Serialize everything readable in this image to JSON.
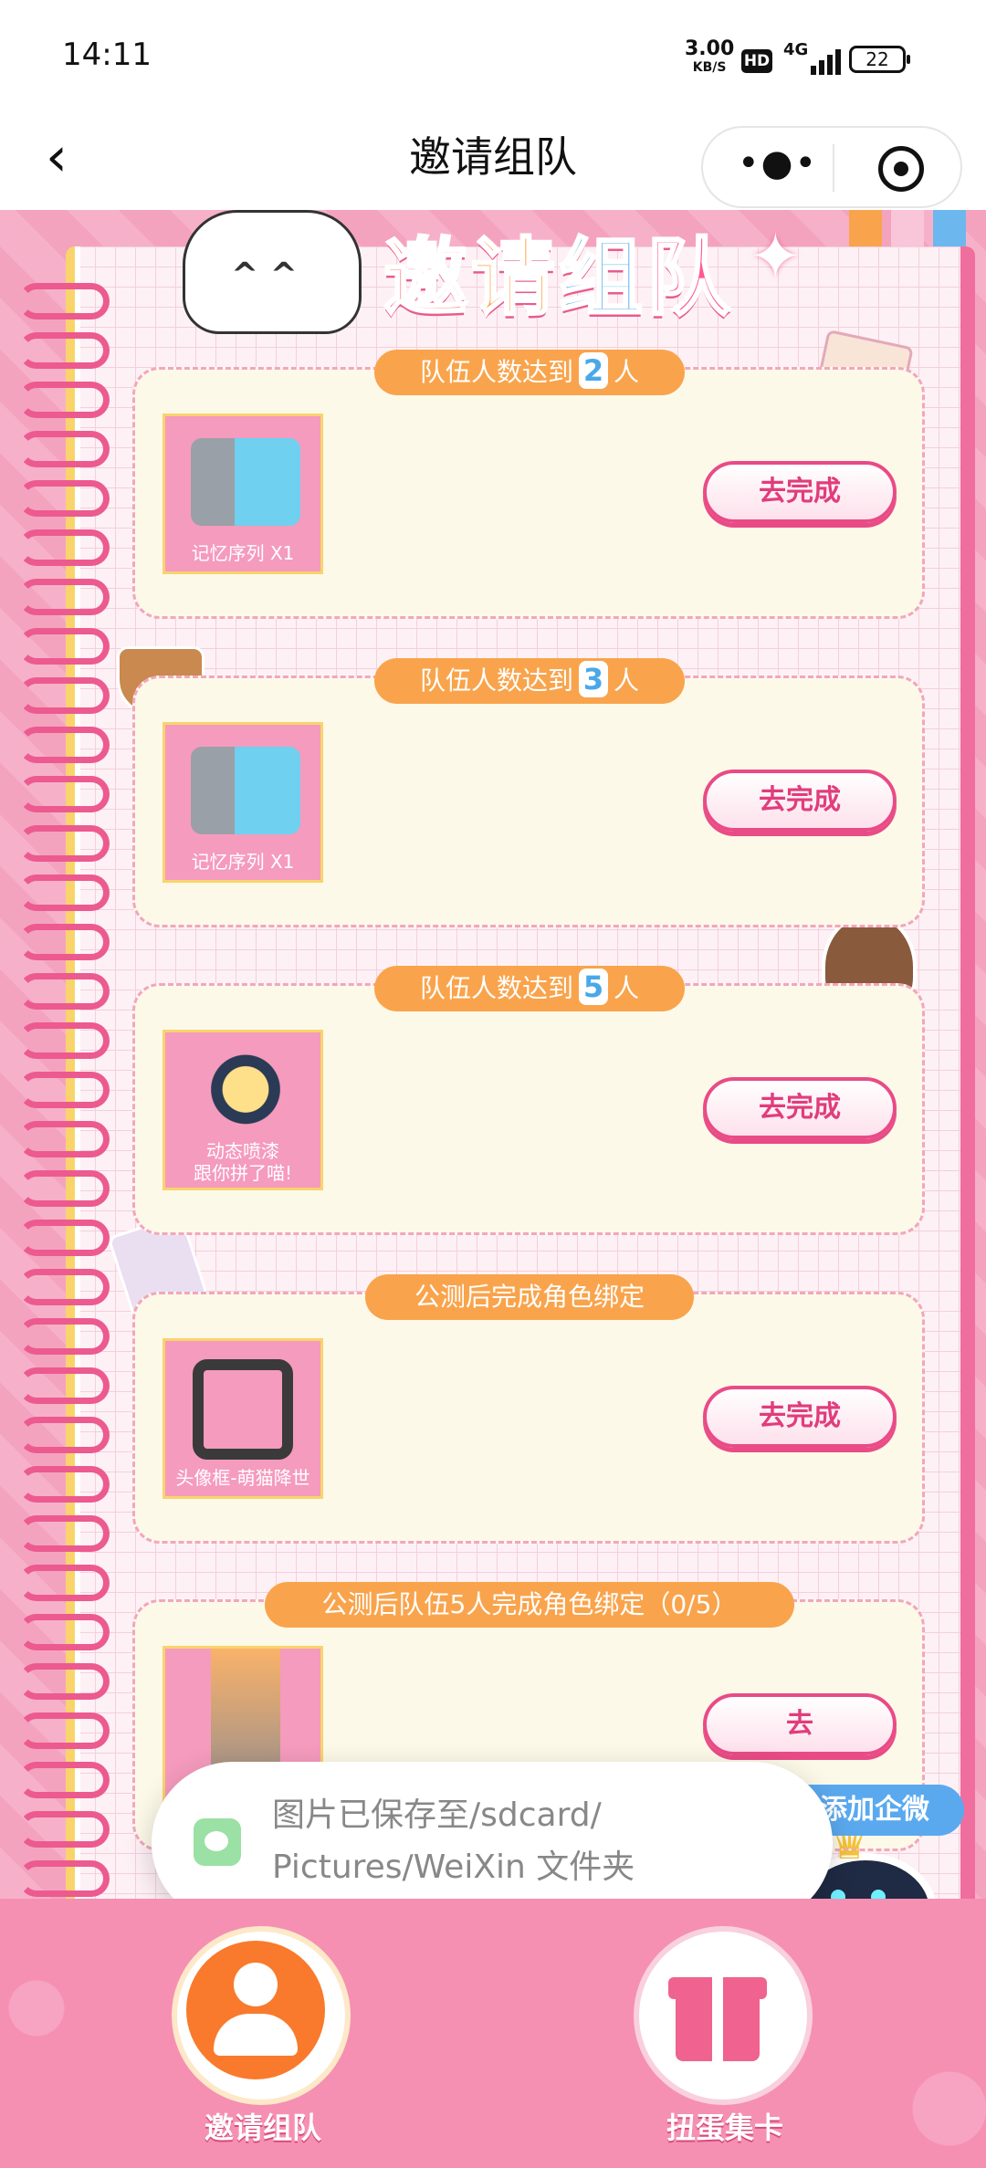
{
  "status_bar": {
    "time": "14:11",
    "net_speed": "3.00",
    "net_unit": "KB/S",
    "hd": "HD",
    "signal": "4G",
    "battery": "22"
  },
  "title_bar": {
    "title": "邀请组队",
    "back_icon": "chevron-left-icon",
    "more_icon": "more-dots-icon",
    "close_icon": "target-icon"
  },
  "banner": {
    "title_chars": [
      "邀",
      "请",
      "组",
      "队"
    ]
  },
  "tasks": [
    {
      "pill_prefix": "队伍人数达到",
      "pill_num": "2",
      "pill_suffix": "人",
      "reward_caption": "记忆序列 X1",
      "button_label": "去完成"
    },
    {
      "pill_prefix": "队伍人数达到",
      "pill_num": "3",
      "pill_suffix": "人",
      "reward_caption": "记忆序列 X1",
      "button_label": "去完成"
    },
    {
      "pill_prefix": "队伍人数达到",
      "pill_num": "5",
      "pill_suffix": "人",
      "reward_caption_line1": "动态喷漆",
      "reward_caption_line2": "跟你拼了喵!",
      "button_label": "去完成"
    },
    {
      "pill_text": "公测后完成角色绑定",
      "reward_caption": "头像框-萌猫降世",
      "button_label": "去完成"
    },
    {
      "pill_text": "公测后队伍5人完成角色绑定（0/5）",
      "button_label": "去"
    }
  ],
  "float_button": {
    "label": "添加企微"
  },
  "toast": {
    "line1": "图片已保存至/sdcard/",
    "line2": "Pictures/WeiXin 文件夹"
  },
  "bottom_nav": [
    {
      "label": "邀请组队",
      "icon": "team-icon"
    },
    {
      "label": "扭蛋集卡",
      "icon": "gift-icon"
    }
  ],
  "colors": {
    "pink": "#f590b2",
    "orange": "#f9a44c",
    "blue": "#4aa8e9",
    "button_pink": "#e94b86"
  }
}
